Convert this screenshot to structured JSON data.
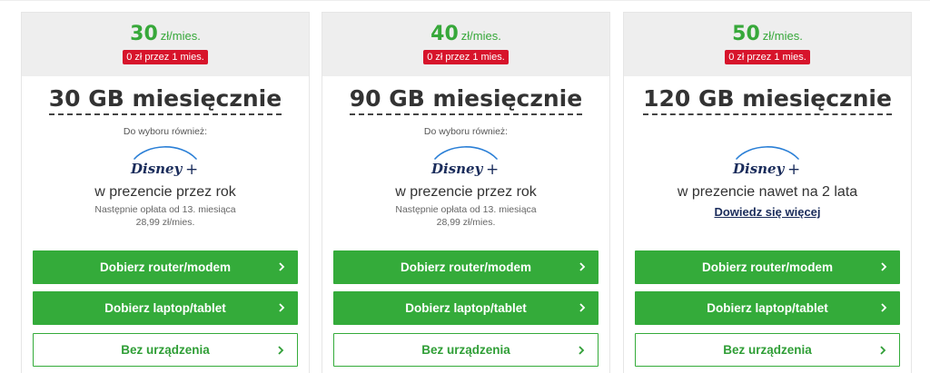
{
  "plans": [
    {
      "price": "30",
      "price_unit": "zł/mies.",
      "promo": "0 zł przez 1 mies.",
      "title": "30 GB miesięcznie",
      "promo_label": "Do wyboru również:",
      "logo": "disney-plus-logo",
      "gift_text": "w prezencie przez rok",
      "note_line1": "Następnie opłata od 13. miesiąca",
      "note_line2": "28,99 zł/mies.",
      "buttons": [
        "Dobierz router/modem",
        "Dobierz laptop/tablet",
        "Bez urządzenia"
      ]
    },
    {
      "price": "40",
      "price_unit": "zł/mies.",
      "promo": "0 zł przez 1 mies.",
      "title": "90 GB miesięcznie",
      "promo_label": "Do wyboru również:",
      "logo": "disney-plus-logo",
      "gift_text": "w prezencie przez rok",
      "note_line1": "Następnie opłata od 13. miesiąca",
      "note_line2": "28,99 zł/mies.",
      "buttons": [
        "Dobierz router/modem",
        "Dobierz laptop/tablet",
        "Bez urządzenia"
      ]
    },
    {
      "price": "50",
      "price_unit": "zł/mies.",
      "promo": "0 zł przez 1 mies.",
      "title": "120 GB miesięcznie",
      "logo": "disney-plus-logo",
      "gift_text": "w prezencie nawet na 2 lata",
      "link": "Dowiedz się więcej",
      "buttons": [
        "Dobierz router/modem",
        "Dobierz laptop/tablet",
        "Bez urządzenia"
      ]
    }
  ],
  "icons": {
    "button_arrow": "chevron-right-icon"
  },
  "colors": {
    "price_green": "#37a83a",
    "button_green": "#34ab3a",
    "promo_red": "#d7142b",
    "header_grey": "#eeeeee",
    "disney_navy": "#1a2c5b",
    "disney_blue": "#2a7fd6"
  }
}
